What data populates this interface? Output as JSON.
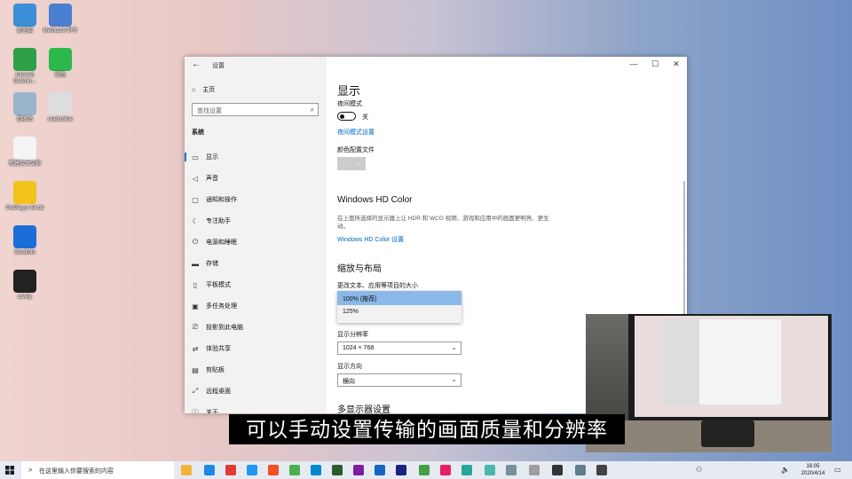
{
  "desktop": {
    "icons": [
      {
        "label": "此电脑",
        "color": "#3a8fd8"
      },
      {
        "label": "Method 8 命令",
        "color": "#4a7fd0"
      },
      {
        "label": "Internet Downlo...",
        "color": "#2fa048"
      },
      {
        "label": "微信",
        "color": "#2db84c"
      },
      {
        "label": "回收站",
        "color": "#9ab4cc"
      },
      {
        "label": "readonline",
        "color": "#dddddd"
      },
      {
        "label": "新建文本文档",
        "color": "#f4f4f4"
      },
      {
        "label": "PotPlayer 64 bit",
        "color": "#f3c21b"
      },
      {
        "label": "Sendinfo",
        "color": "#1b6ed8"
      },
      {
        "label": "Lively",
        "color": "#222222"
      }
    ]
  },
  "window": {
    "title": "设置",
    "controls": {
      "minimize": "—",
      "maximize": "☐",
      "close": "✕"
    },
    "sidebar": {
      "home_label": "主页",
      "search_placeholder": "查找设置",
      "category": "系统",
      "items": [
        {
          "label": "显示",
          "icon": "monitor-icon"
        },
        {
          "label": "声音",
          "icon": "speaker-icon"
        },
        {
          "label": "通知和操作",
          "icon": "notification-icon"
        },
        {
          "label": "专注助手",
          "icon": "moon-icon"
        },
        {
          "label": "电源和睡眠",
          "icon": "power-icon"
        },
        {
          "label": "存储",
          "icon": "storage-icon"
        },
        {
          "label": "平板模式",
          "icon": "tablet-icon"
        },
        {
          "label": "多任务处理",
          "icon": "multitask-icon"
        },
        {
          "label": "投影到此电脑",
          "icon": "project-icon"
        },
        {
          "label": "体验共享",
          "icon": "share-icon"
        },
        {
          "label": "剪贴板",
          "icon": "clipboard-icon"
        },
        {
          "label": "远程桌面",
          "icon": "remote-icon"
        },
        {
          "label": "关于",
          "icon": "info-icon"
        }
      ]
    },
    "main": {
      "heading": "显示",
      "night_mode_label": "夜间模式",
      "night_mode_state": "关",
      "night_mode_link": "夜间模式设置",
      "color_profile_label": "颜色配置文件",
      "hd_color_heading": "Windows HD Color",
      "hd_color_desc": "在上面所选择的显示器上让 HDR 和 WCG 视频、游戏和应用中的画面更明亮、更生动。",
      "hd_color_link": "Windows HD Color 设置",
      "scale_heading": "缩放与布局",
      "scale_label": "更改文本、应用等项目的大小",
      "scale_options": [
        "100% (推荐)",
        "125%"
      ],
      "resolution_label": "显示分辨率",
      "resolution_value": "1024 × 768",
      "orientation_label": "显示方向",
      "orientation_value": "横向",
      "multi_display_heading": "多显示器设置"
    }
  },
  "subtitle": "可以手动设置传输的画面质量和分辨率",
  "taskbar": {
    "search_placeholder": "在这里输入你要搜索的内容",
    "time": "16:05",
    "date": "2020/4/14",
    "apps": [
      "#f3b43a",
      "#1e88e5",
      "#e53935",
      "#2196f3",
      "#f4511e",
      "#4caf50",
      "#0288d1",
      "#2c5c2c",
      "#7b1fa2",
      "#1565c0",
      "#1a237e",
      "#43a047",
      "#e91e63",
      "#26a69a",
      "#4db6ac",
      "#78909c",
      "#9e9e9e",
      "#333333",
      "#607d8b",
      "#424242"
    ]
  }
}
